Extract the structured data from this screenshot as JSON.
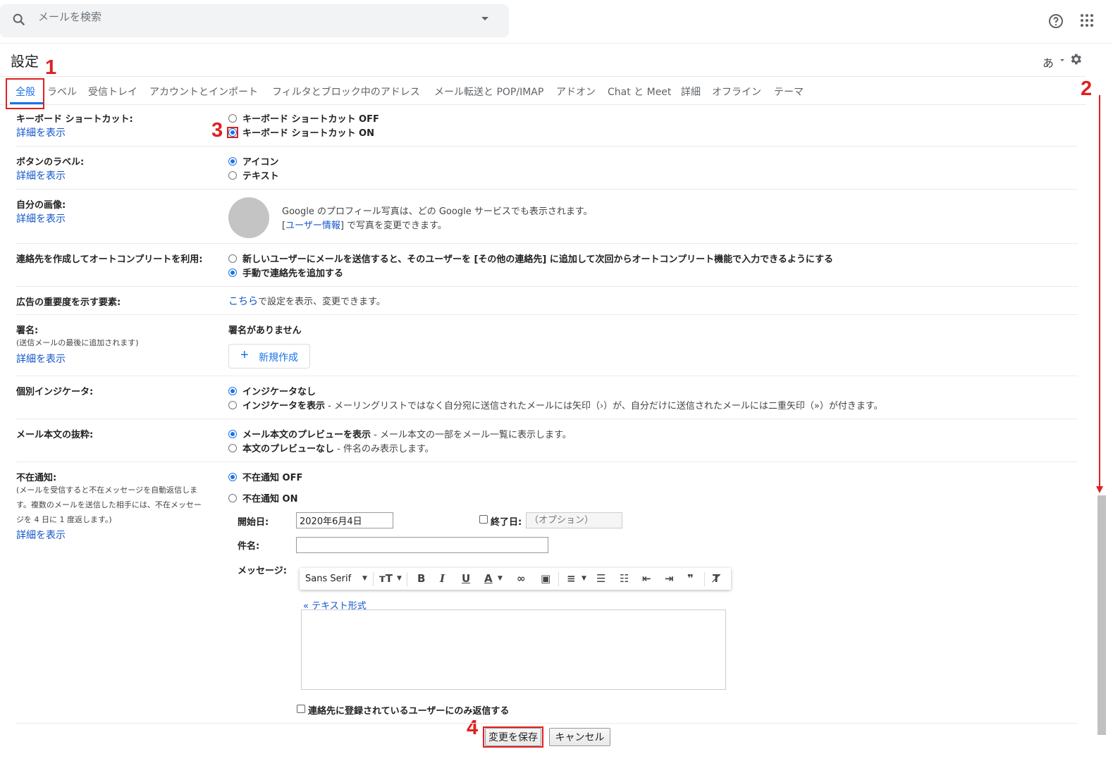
{
  "search": {
    "placeholder": "メールを検索"
  },
  "page_title": "設定",
  "ime": "あ",
  "tabs": [
    {
      "label": "全般"
    },
    {
      "label": "ラベル"
    },
    {
      "label": "受信トレイ"
    },
    {
      "label": "アカウントとインポート"
    },
    {
      "label": "フィルタとブロック中のアドレス"
    },
    {
      "label": "メール転送と POP/IMAP"
    },
    {
      "label": "アドオン"
    },
    {
      "label": "Chat と Meet"
    },
    {
      "label": "詳細"
    },
    {
      "label": "オフライン"
    },
    {
      "label": "テーマ"
    }
  ],
  "annotations": {
    "n1": "1",
    "n2": "2",
    "n3": "3",
    "n4": "4"
  },
  "details_link": "詳細を表示",
  "keyboard": {
    "label": "キーボード ショートカット:",
    "off": "キーボード ショートカット OFF",
    "on": "キーボード ショートカット ON"
  },
  "button_labels": {
    "label": "ボタンのラベル:",
    "icon": "アイコン",
    "text": "テキスト"
  },
  "picture": {
    "label": "自分の画像:",
    "line1": "Google のプロフィール写真は、どの Google サービスでも表示されます。",
    "bracket_open": "[",
    "user_info_link": "ユーザー情報",
    "line2_rest": "] で写真を変更できます。"
  },
  "autocomplete": {
    "label": "連絡先を作成してオートコンプリートを利用:",
    "auto": "新しいユーザーにメールを送信すると、そのユーザーを [その他の連絡先] に追加して次回からオートコンプリート機能で入力できるようにする",
    "manual": "手動で連絡先を追加する"
  },
  "ads": {
    "label": "広告の重要度を示す要素:",
    "link": "こちら",
    "rest": "で設定を表示、変更できます。"
  },
  "signature": {
    "label": "署名:",
    "sub": "(送信メールの最後に追加されます)",
    "none": "署名がありません",
    "new_button": "新規作成"
  },
  "indicators": {
    "label": "個別インジケータ:",
    "none": "インジケータなし",
    "show": "インジケータを表示",
    "show_desc": " - メーリングリストではなく自分宛に送信されたメールには矢印（›）が、自分だけに送信されたメールには二重矢印（»）が付きます。"
  },
  "snippets": {
    "label": "メール本文の抜粋:",
    "show": "メール本文のプレビューを表示",
    "show_desc": " - メール本文の一部をメール一覧に表示します。",
    "hide": "本文のプレビューなし",
    "hide_desc": " - 件名のみ表示します。"
  },
  "vacation": {
    "label": "不在通知:",
    "sub": [
      "(メールを受信すると不在メッセージを自動返信しま",
      "す。複数のメールを送信した相手には、不在メッセー",
      "ジを 4 日に 1 度返します。)"
    ],
    "off": "不在通知 OFF",
    "on": "不在通知 ON",
    "start_label": "開始日:",
    "start_value": "2020年6月4日",
    "end_label": "終了日:",
    "end_placeholder": "（オプション）",
    "subject_label": "件名:",
    "message_label": "メッセージ:",
    "font": "Sans Serif",
    "plain_text": "« テキスト形式",
    "contacts_only": "連絡先に登録されているユーザーにのみ返信する"
  },
  "actions": {
    "save": "変更を保存",
    "cancel": "キャンセル"
  },
  "colors": {
    "accent": "#1a73e8",
    "link": "#1155cc",
    "annotation": "#e02020"
  }
}
